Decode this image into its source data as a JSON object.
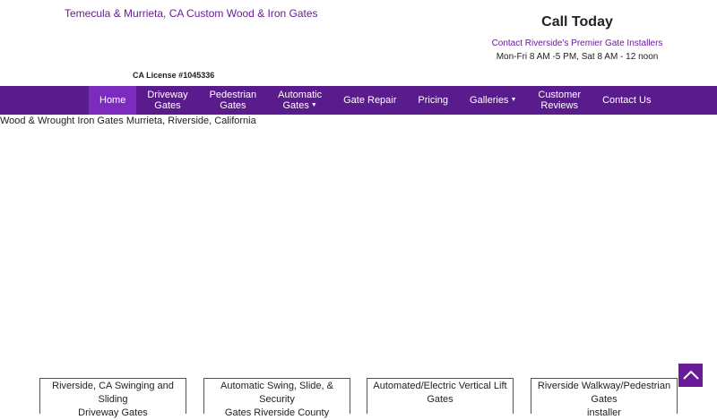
{
  "header": {
    "tagline": "Temecula & Murrieta, CA Custom Wood & Iron Gates",
    "license": "CA License #1045336",
    "call_title": "Call Today",
    "call_link": "Contact Riverside's Premier Gate Installers",
    "hours": "Mon-Fri 8 AM -5 PM, Sat 8 AM - 12 noon"
  },
  "nav": {
    "items": [
      {
        "line1": "Home",
        "line2": ""
      },
      {
        "line1": "Driveway",
        "line2": "Gates"
      },
      {
        "line1": "Pedestrian",
        "line2": "Gates"
      },
      {
        "line1": "Automatic",
        "line2": "Gates"
      },
      {
        "line1": "Gate Repair",
        "line2": ""
      },
      {
        "line1": "Pricing",
        "line2": ""
      },
      {
        "line1": "Galleries",
        "line2": ""
      },
      {
        "line1": "Customer",
        "line2": "Reviews"
      },
      {
        "line1": "Contact Us",
        "line2": ""
      }
    ],
    "active_item": "Home"
  },
  "main": {
    "heading": "Wood & Wrought Iron Gates Murrieta, Riverside, California",
    "cards": [
      {
        "line1": "Riverside, CA Swinging and Sliding",
        "line2": "Driveway Gates"
      },
      {
        "line1": "Automatic Swing, Slide, & Security",
        "line2": "Gates Riverside County"
      },
      {
        "line1": "Automated/Electric Vertical Lift",
        "line2": "Gates"
      },
      {
        "line1": "Riverside Walkway/Pedestrian Gates",
        "line2": "installer"
      }
    ]
  },
  "icons": {
    "back_to_top": "chevron-up-icon",
    "dropdown": "caret-down-icon"
  },
  "colors": {
    "nav_bg": "#5a1b8c",
    "nav_active": "#7b2cbf",
    "accent_text": "#6a1b9a",
    "back_to_top_bg": "#6a1b9a"
  }
}
